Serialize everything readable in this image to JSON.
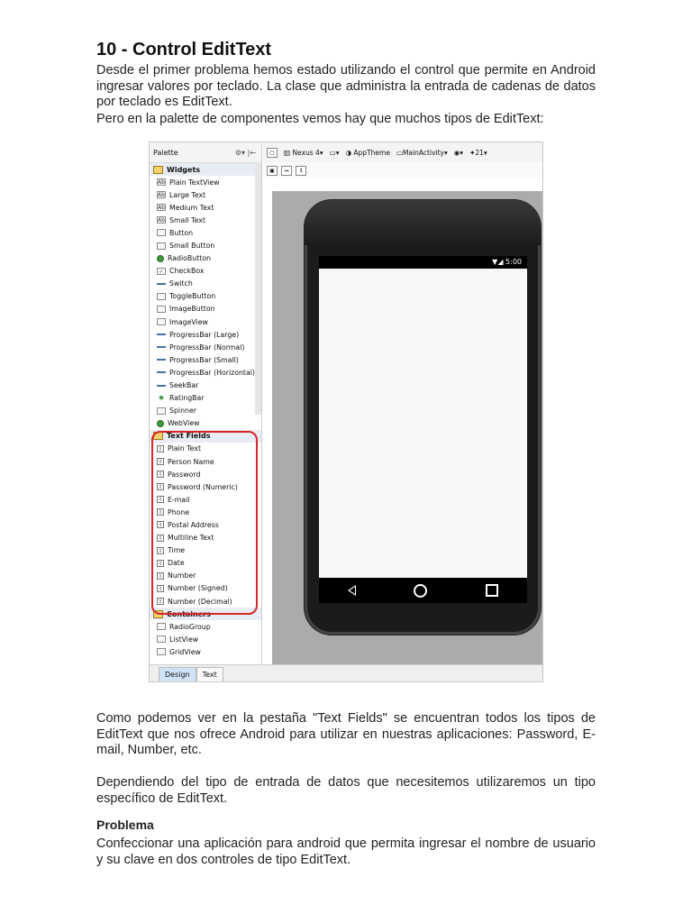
{
  "title": "10 - Control EditText",
  "intro": "Desde el primer problema hemos estado utilizando el control que permite en Android ingresar valores por teclado. La clase que administra la entrada de cadenas de datos por teclado es EditText.",
  "intro2": "Pero en la palette de componentes vemos hay que muchos tipos de EditText:",
  "figure": {
    "palette_title": "Palette",
    "widgets_group": "Widgets",
    "widgets": [
      "Plain TextView",
      "Large Text",
      "Medium Text",
      "Small Text",
      "Button",
      "Small Button",
      "RadioButton",
      "CheckBox",
      "Switch",
      "ToggleButton",
      "ImageButton",
      "ImageView",
      "ProgressBar (Large)",
      "ProgressBar (Normal)",
      "ProgressBar (Small)",
      "ProgressBar (Horizontal)",
      "SeekBar",
      "RatingBar",
      "Spinner",
      "WebView"
    ],
    "textfields_group": "Text Fields",
    "textfields": [
      "Plain Text",
      "Person Name",
      "Password",
      "Password (Numeric)",
      "E-mail",
      "Phone",
      "Postal Address",
      "Multiline Text",
      "Time",
      "Date",
      "Number",
      "Number (Signed)",
      "Number (Decimal)"
    ],
    "containers_group": "Containers",
    "containers": [
      "RadioGroup",
      "ListView",
      "GridView"
    ],
    "toolbar": {
      "device": "Nexus 4",
      "theme": "AppTheme",
      "activity": "MainActivity",
      "api": "21"
    },
    "status_time": "5:00",
    "tab_design": "Design",
    "tab_text": "Text"
  },
  "para3": "Como podemos ver en la pestaña \"Text Fields\" se encuentran todos los tipos de EditText que nos ofrece Android para utilizar en nuestras aplicaciones: Password, E-mail, Number, etc.",
  "para4": "Dependiendo del tipo de entrada de datos que necesitemos utilizaremos un tipo específico de EditText.",
  "problem_heading": "Problema",
  "para5": "Confeccionar una aplicación para android que permita ingresar el nombre de usuario y su clave en dos controles de tipo EditText."
}
